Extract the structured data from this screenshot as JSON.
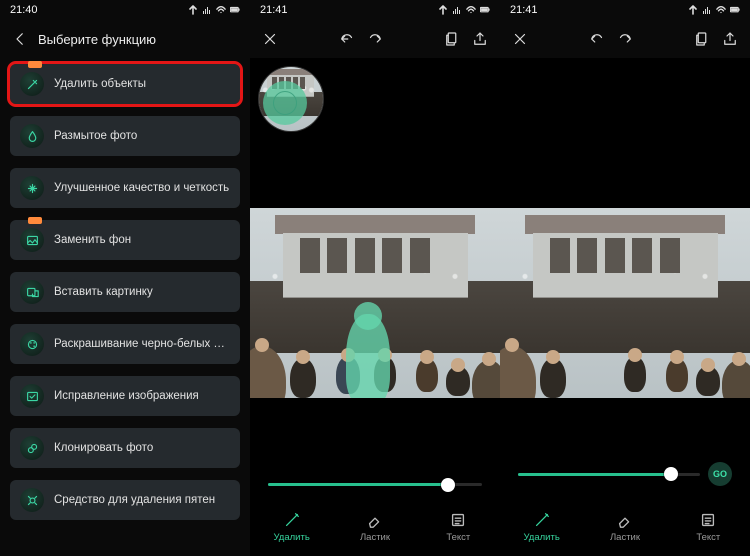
{
  "status": {
    "left_time": "21:40",
    "mid_time": "21:41",
    "right_time": "21:41"
  },
  "left_panel": {
    "title": "Выберите функцию",
    "items": [
      {
        "label": "Удалить объекты",
        "highlighted": true,
        "new": true
      },
      {
        "label": "Размытое фото",
        "highlighted": false,
        "new": false
      },
      {
        "label": "Улучшенное качество и четкость",
        "highlighted": false,
        "new": false
      },
      {
        "label": "Заменить фон",
        "highlighted": false,
        "new": true
      },
      {
        "label": "Вставить картинку",
        "highlighted": false,
        "new": false
      },
      {
        "label": "Раскрашивание черно-белых фотограф",
        "highlighted": false,
        "new": false
      },
      {
        "label": "Исправление изображения",
        "highlighted": false,
        "new": false
      },
      {
        "label": "Клонировать фото",
        "highlighted": false,
        "new": false
      },
      {
        "label": "Средство для удаления пятен",
        "highlighted": false,
        "new": false
      }
    ]
  },
  "editor": {
    "tools": [
      {
        "label": "Удалить",
        "active": true
      },
      {
        "label": "Ластик",
        "active": false
      },
      {
        "label": "Текст",
        "active": false
      }
    ],
    "slider_percent": 84,
    "go_label": "GO"
  },
  "colors": {
    "accent": "#2fd49a",
    "highlight_border": "#e41616",
    "panel_bg": "#252a2e"
  }
}
